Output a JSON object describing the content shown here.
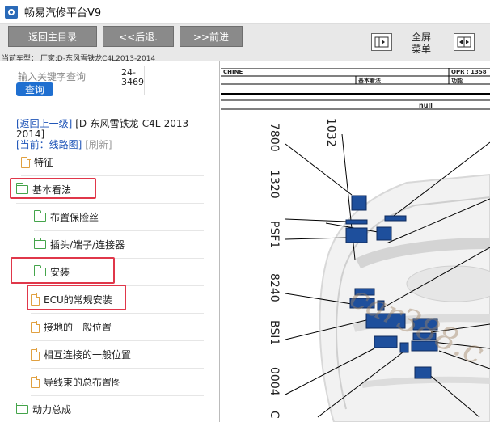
{
  "window": {
    "title": "畅易汽修平台V9"
  },
  "toolbar": {
    "back_main": "返回主目录",
    "prev": "<<后退.",
    "next": ">>前进",
    "fullscreen_line1": "全屏",
    "fullscreen_line2": "菜单",
    "car_model": "当前车型： 厂家:D-东风雪铁龙C4L2013-2014"
  },
  "search": {
    "label": "输入关键字查询",
    "button": "查询",
    "range_line1": "24-",
    "range_line2": "3469"
  },
  "nav": {
    "up_link": "[返回上一级]",
    "title": "[D-东风雪铁龙-C4L-2013-2014]",
    "current": "[当前：线路图]",
    "refresh": "[刷新]"
  },
  "tree": [
    {
      "label": "特征",
      "icon": "doc-icon"
    },
    {
      "label": "基本看法",
      "icon": "folder-icon"
    },
    {
      "label": "布置保险丝",
      "icon": "folder-icon"
    },
    {
      "label": "插头/端子/连接器",
      "icon": "folder-icon"
    },
    {
      "label": "安装",
      "icon": "folder-icon"
    },
    {
      "label": "ECU的常规安装",
      "icon": "doc-icon"
    },
    {
      "label": "接地的一般位置",
      "icon": "doc-icon"
    },
    {
      "label": "相互连接的一般位置",
      "icon": "doc-icon"
    },
    {
      "label": "导线束的总布置图",
      "icon": "doc-icon"
    },
    {
      "label": "动力总成",
      "icon": "folder-icon"
    }
  ],
  "highlight_color": "#e0374a",
  "diagram": {
    "header": {
      "chine": "CHINE",
      "opr": "OPR : 1358",
      "basic": "基本看法",
      "func": "功能",
      "null": "null"
    },
    "labels": [
      "7800",
      "1032",
      "1320",
      "PSF1",
      "8240",
      "BSI1",
      "0004",
      "C"
    ],
    "watermark": "car388.c",
    "component_color": "#1e4f9c"
  }
}
